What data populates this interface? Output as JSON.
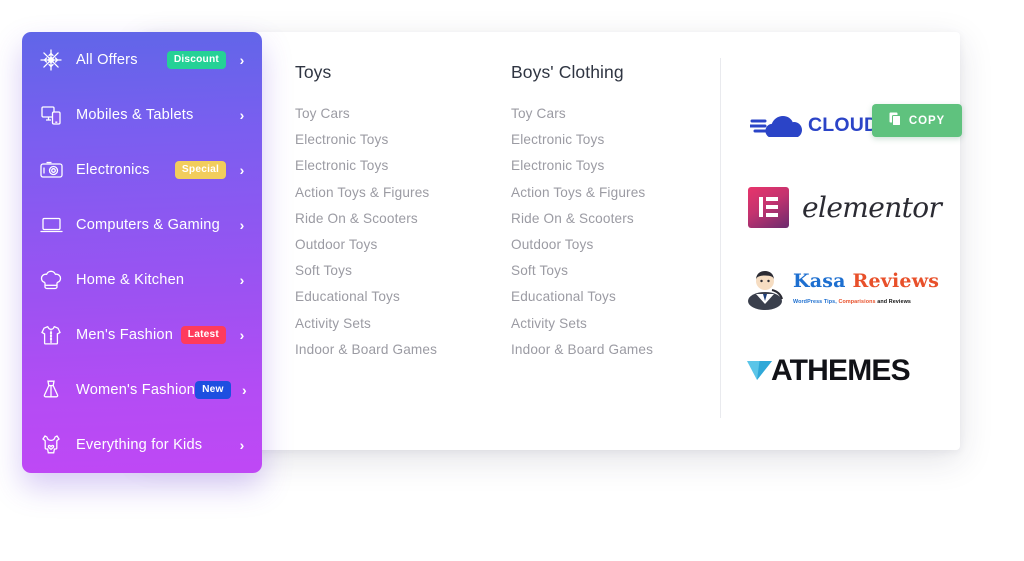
{
  "sidebar": {
    "items": [
      {
        "label": "All Offers",
        "icon": "snowflake-icon",
        "badge": "Discount",
        "badge_color": "#25d196",
        "arrow": "›"
      },
      {
        "label": "Mobiles & Tablets",
        "icon": "devices-icon",
        "badge": "",
        "badge_color": "",
        "arrow": "›"
      },
      {
        "label": "Electronics",
        "icon": "camera-icon",
        "badge": "Special",
        "badge_color": "#f2cd5c",
        "arrow": "›"
      },
      {
        "label": "Computers & Gaming",
        "icon": "laptop-icon",
        "badge": "",
        "badge_color": "",
        "arrow": "›"
      },
      {
        "label": "Home & Kitchen",
        "icon": "chef-hat-icon",
        "badge": "",
        "badge_color": "",
        "arrow": "›"
      },
      {
        "label": "Men's Fashion",
        "icon": "shirt-icon",
        "badge": "Latest",
        "badge_color": "#ff3b5c",
        "arrow": "›"
      },
      {
        "label": "Women's Fashion",
        "icon": "dress-icon",
        "badge": "New",
        "badge_color": "#1e4fe0",
        "arrow": "›"
      },
      {
        "label": "Everything for Kids",
        "icon": "baby-onesie-icon",
        "badge": "",
        "badge_color": "",
        "arrow": "›"
      }
    ]
  },
  "mega_menu": {
    "columns": [
      {
        "title": "Toys",
        "links": [
          "Toy Cars",
          "Electronic Toys",
          "Electronic Toys",
          "Action Toys & Figures",
          "Ride On & Scooters",
          "Outdoor Toys",
          "Soft Toys",
          "Educational Toys",
          "Activity Sets",
          "Indoor & Board Games"
        ]
      },
      {
        "title": "Boys' Clothing",
        "links": [
          "Toy Cars",
          "Electronic Toys",
          "Electronic Toys",
          "Action Toys & Figures",
          "Ride On & Scooters",
          "Outdoor Toys",
          "Soft Toys",
          "Educational Toys",
          "Activity Sets",
          "Indoor & Board Games"
        ]
      }
    ],
    "brands": [
      {
        "name": "Cloudways",
        "text": "CLOUDWAYS",
        "color": "#2b44c7"
      },
      {
        "name": "Elementor",
        "text": "elementor",
        "color": "#2b2b33"
      },
      {
        "name": "Kasa Reviews",
        "text_1": "Kasa",
        "text_2": "Reviews",
        "tagline_1": "WordPress Tips,",
        "tagline_2": "Comparisions",
        "tagline_3": "and Reviews"
      },
      {
        "name": "aThemes",
        "text": "ATHEMES",
        "color": "#111217"
      }
    ]
  },
  "copy_button": {
    "label": "COPY",
    "icon": "clipboard-copy-icon",
    "color": "#5fc27e"
  }
}
